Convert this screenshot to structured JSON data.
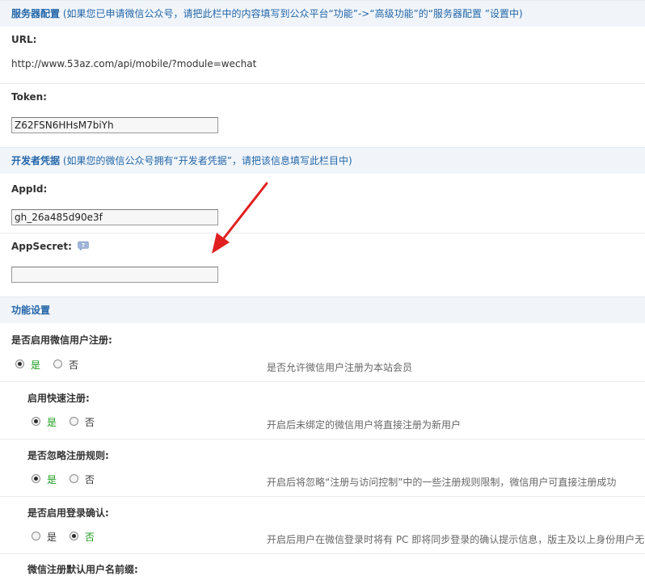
{
  "server_section": {
    "title": "服务器配置",
    "note": "(如果您已申请微信公众号，请把此栏中的内容填写到公众平台“功能”->“高级功能”的“服务器配置 ”设置中)",
    "url_label": "URL:",
    "url_value": "http://www.53az.com/api/mobile/?module=wechat",
    "token_label": "Token:",
    "token_value": "Z62FSN6HHsM7biYh"
  },
  "dev_section": {
    "title": "开发者凭据",
    "note": "(如果您的微信公众号拥有“开发者凭据”，请把该信息填写此栏目中)",
    "appid_label": "AppId:",
    "appid_value": "gh_26a485d90e3f",
    "appsecret_label": "AppSecret:",
    "appsecret_value": ""
  },
  "func_section": {
    "title": "功能设置",
    "settings": [
      {
        "label": "是否启用微信用户注册:",
        "yes": "是",
        "no": "否",
        "selected": "yes",
        "desc": "是否允许微信用户注册为本站会员"
      },
      {
        "label": "启用快速注册:",
        "yes": "是",
        "no": "否",
        "selected": "yes",
        "desc": "开启后未绑定的微信用户将直接注册为新用户"
      },
      {
        "label": "是否忽略注册规则:",
        "yes": "是",
        "no": "否",
        "selected": "yes",
        "desc": "开启后将忽略“注册与访问控制”中的一些注册规则限制，微信用户可直接注册成功"
      },
      {
        "label": "是否启用登录确认:",
        "yes": "是",
        "no": "否",
        "selected": "no",
        "desc": "开启后用户在微信登录时将有 PC 即将同步登录的确认提示信息，版主及以上身份用户无"
      },
      {
        "label": "微信注册默认用户名前缀:"
      }
    ]
  },
  "colors": {
    "section_bg": "#f1f5fa",
    "section_text": "#2366a8",
    "active_option": "#1a9a1a",
    "arrow": "#e02020"
  },
  "icons": {
    "help": "question-bubble-icon",
    "annotation": "red-arrow"
  }
}
